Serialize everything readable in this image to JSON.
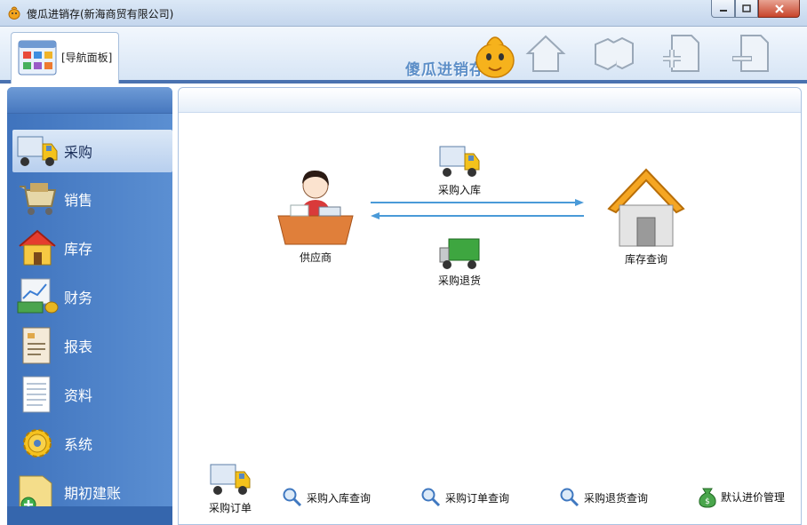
{
  "window": {
    "title": "傻瓜进销存(新海商贸有限公司)"
  },
  "toolbar": {
    "nav_panel_label": "[导航面板]",
    "brand_text": "傻瓜进销存",
    "icons": [
      "home-icon",
      "cubes-icon",
      "add-page-icon",
      "remove-page-icon"
    ]
  },
  "sidebar": {
    "items": [
      {
        "label": "采购",
        "icon": "truck-icon",
        "active": true
      },
      {
        "label": "销售",
        "icon": "shopping-cart-icon",
        "active": false
      },
      {
        "label": "库存",
        "icon": "warehouse-house-icon",
        "active": false
      },
      {
        "label": "财务",
        "icon": "money-chart-icon",
        "active": false
      },
      {
        "label": "报表",
        "icon": "report-icon",
        "active": false
      },
      {
        "label": "资料",
        "icon": "document-icon",
        "active": false
      },
      {
        "label": "系统",
        "icon": "gear-icon",
        "active": false
      },
      {
        "label": "期初建账",
        "icon": "folder-add-icon",
        "active": false
      }
    ]
  },
  "flow": {
    "supplier": "供应商",
    "purchase_in": "采购入库",
    "purchase_return": "采购退货",
    "stock_query": "库存查询"
  },
  "bottom": {
    "purchase_order": "采购订单",
    "in_query": "采购入库查询",
    "order_query": "采购订单查询",
    "return_query": "采购退货查询",
    "price_mgmt": "默认进价管理"
  },
  "colors": {
    "sidebar": "#4a7fc6",
    "accent": "#4a72b0",
    "arrow": "#4a9ad8"
  }
}
